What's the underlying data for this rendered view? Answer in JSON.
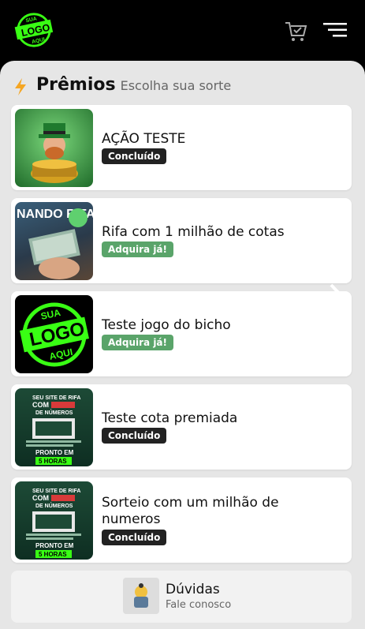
{
  "header": {
    "logo": {
      "top": "SUA",
      "mid": "LOGO",
      "bottom": "AQUI"
    },
    "cart_icon": "cart-icon",
    "menu_icon": "menu-icon"
  },
  "section": {
    "title": "Prêmios",
    "subtitle": "Escolha sua sorte",
    "icon": "lightning-icon"
  },
  "cards": [
    {
      "title": "AÇÃO TESTE",
      "status": "Concluído",
      "status_type": "done",
      "thumb": "leprechaun-gold"
    },
    {
      "title": "Rifa com 1 milhão de cotas",
      "status": "Adquira já!",
      "status_type": "buy",
      "thumb": "money-hand",
      "thumb_text": "NANDO RIFAS"
    },
    {
      "title": "Teste jogo do bicho",
      "status": "Adquira já!",
      "status_type": "buy",
      "thumb": "logo",
      "logo": {
        "top": "SUA",
        "mid": "LOGO",
        "bottom": "AQUI"
      }
    },
    {
      "title": "Teste cota premiada",
      "status": "Concluído",
      "status_type": "done",
      "thumb": "promo-site",
      "promo": {
        "line1": "SEU SITE DE RIFA",
        "line2": "COM",
        "line3": "DE NÚMEROS",
        "line4": "PRONTO EM",
        "line5": "5 HORAS"
      }
    },
    {
      "title": "Sorteio com um milhão de numeros",
      "status": "Concluído",
      "status_type": "done",
      "thumb": "promo-site",
      "promo": {
        "line1": "SEU SITE DE RIFA",
        "line2": "COM",
        "line3": "DE NÚMEROS",
        "line4": "PRONTO EM",
        "line5": "5 HORAS"
      }
    }
  ],
  "faq": {
    "title": "Dúvidas",
    "subtitle": "Fale conosco",
    "icon": "support-icon"
  },
  "colors": {
    "done": "#222222",
    "buy": "#5aa46a",
    "logo_green": "#39ff14"
  }
}
